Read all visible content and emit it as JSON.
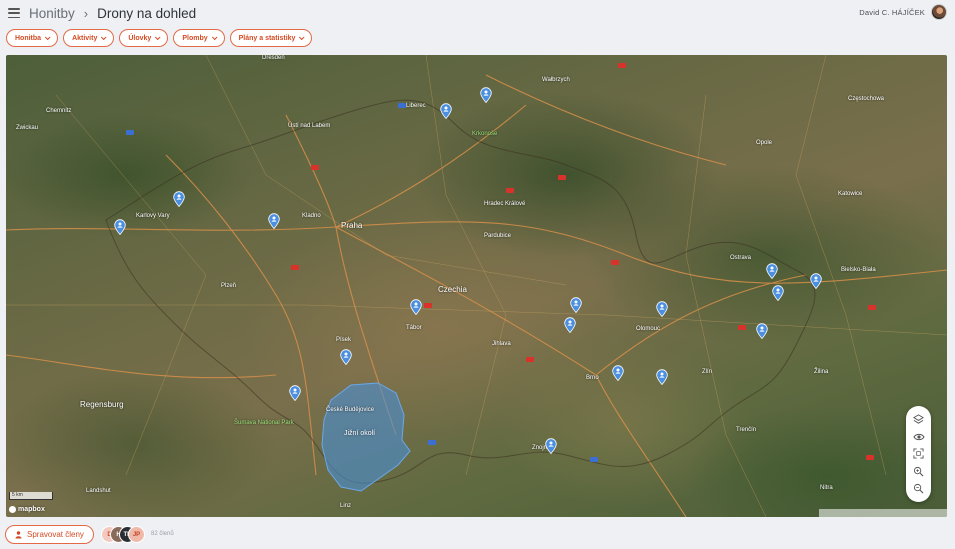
{
  "header": {
    "breadcrumb_root": "Honitby",
    "page_title": "Drony na dohled",
    "user_name": "David C. HÁJÍČEK"
  },
  "filters": [
    {
      "label": "Honitba"
    },
    {
      "label": "Aktivity"
    },
    {
      "label": "Úlovky"
    },
    {
      "label": "Plomby"
    },
    {
      "label": "Plány a statistiky"
    }
  ],
  "map": {
    "zone_label": "Jižní okolí",
    "scale_label": "5 km",
    "provider": "mapbox",
    "labels": {
      "dresden": "Dresden",
      "ustim": "Ústí nad Labem",
      "liberec": "Liberec",
      "walbrzych": "Wałbrzych",
      "opole": "Opole",
      "katowice": "Katowice",
      "czestochowa": "Częstochowa",
      "praha": "Praha",
      "czechia": "Czechia",
      "plzen": "Plzeň",
      "brno": "Brno",
      "ostrava": "Ostrava",
      "olomouc": "Olomouc",
      "zlin": "Zlín",
      "regensburg": "Regensburg",
      "landshut": "Landshut",
      "linz": "Linz",
      "ceske_budejovice": "České Budějovice",
      "krkonose": "Krkonoše",
      "sumava": "Šumava National Park",
      "bielsko": "Bielsko-Biała",
      "trencin": "Trenčín",
      "zilina": "Žilina",
      "jihlava": "Jihlava",
      "hradec": "Hradec Králové",
      "pardubice": "Pardubice",
      "chemnitz": "Chemnitz",
      "zwickau": "Zwickau",
      "karlovy": "Karlovy Vary",
      "kladno": "Kladno",
      "tabor": "Tábor",
      "pisek": "Písek",
      "znojmo": "Znojmo",
      "nitra": "Nitra"
    }
  },
  "members": {
    "avatars": [
      "D",
      "H",
      "TH",
      "JP"
    ],
    "count_label": "82 členů",
    "manage_label": "Spravovat členy"
  },
  "colors": {
    "accent": "#d44a24",
    "pin": "#4a8fe0",
    "zone": "#4a8fd6"
  }
}
